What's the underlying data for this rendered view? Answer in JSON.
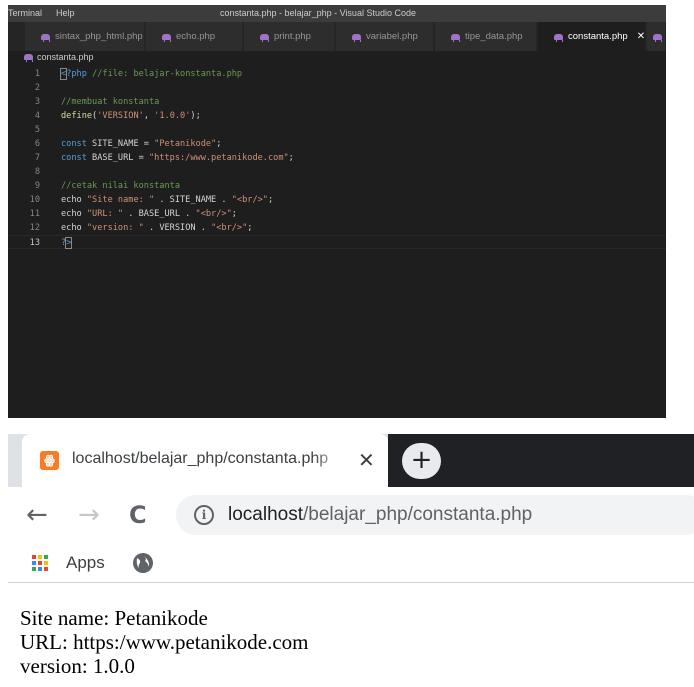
{
  "vscode": {
    "menu": [
      "Terminal",
      "Help"
    ],
    "window_title": "constanta.php - belajar_php - Visual Studio Code",
    "tabs": [
      {
        "label": "sintax_php_html.php",
        "active": false
      },
      {
        "label": "echo.php",
        "active": false
      },
      {
        "label": "print.php",
        "active": false
      },
      {
        "label": "variabel.php",
        "active": false
      },
      {
        "label": "tipe_data.php",
        "active": false
      },
      {
        "label": "constanta.php",
        "active": true
      }
    ],
    "close_glyph": "✕",
    "breadcrumb": "constanta.php",
    "current_line": 13,
    "lines": [
      {
        "n": "1",
        "tokens": [
          {
            "t": "<",
            "c": "t-tag bracket"
          },
          {
            "t": "?php ",
            "c": "t-tag"
          },
          {
            "t": "//file: belajar-konstanta.php",
            "c": "t-comment"
          }
        ]
      },
      {
        "n": "2",
        "tokens": []
      },
      {
        "n": "3",
        "tokens": [
          {
            "t": "//membuat konstanta",
            "c": "t-comment"
          }
        ]
      },
      {
        "n": "4",
        "tokens": [
          {
            "t": "define",
            "c": "t-func"
          },
          {
            "t": "(",
            "c": "t-plain"
          },
          {
            "t": "'VERSION'",
            "c": "t-string"
          },
          {
            "t": ", ",
            "c": "t-plain"
          },
          {
            "t": "'1.0.0'",
            "c": "t-string"
          },
          {
            "t": ");",
            "c": "t-plain"
          }
        ]
      },
      {
        "n": "5",
        "tokens": []
      },
      {
        "n": "6",
        "tokens": [
          {
            "t": "const",
            "c": "t-keyword"
          },
          {
            "t": " SITE_NAME = ",
            "c": "t-plain"
          },
          {
            "t": "\"Petanikode\"",
            "c": "t-string"
          },
          {
            "t": ";",
            "c": "t-plain"
          }
        ]
      },
      {
        "n": "7",
        "tokens": [
          {
            "t": "const",
            "c": "t-keyword"
          },
          {
            "t": " BASE_URL = ",
            "c": "t-plain"
          },
          {
            "t": "\"https:/www.petanikode.com\"",
            "c": "t-string"
          },
          {
            "t": ";",
            "c": "t-plain"
          }
        ]
      },
      {
        "n": "8",
        "tokens": []
      },
      {
        "n": "9",
        "tokens": [
          {
            "t": "//cetak nilai konstanta",
            "c": "t-comment"
          }
        ]
      },
      {
        "n": "10",
        "tokens": [
          {
            "t": "echo ",
            "c": "t-plain"
          },
          {
            "t": "\"Site name: \"",
            "c": "t-string"
          },
          {
            "t": " . SITE_NAME . ",
            "c": "t-plain"
          },
          {
            "t": "\"<br/>\"",
            "c": "t-string"
          },
          {
            "t": ";",
            "c": "t-plain"
          }
        ]
      },
      {
        "n": "11",
        "tokens": [
          {
            "t": "echo ",
            "c": "t-plain"
          },
          {
            "t": "\"URL: \"",
            "c": "t-string"
          },
          {
            "t": " . BASE_URL . ",
            "c": "t-plain"
          },
          {
            "t": "\"<br/>\"",
            "c": "t-string"
          },
          {
            "t": ";",
            "c": "t-plain"
          }
        ]
      },
      {
        "n": "12",
        "tokens": [
          {
            "t": "echo ",
            "c": "t-plain"
          },
          {
            "t": "\"version: \"",
            "c": "t-string"
          },
          {
            "t": " . VERSION . ",
            "c": "t-plain"
          },
          {
            "t": "\"<br/>\"",
            "c": "t-string"
          },
          {
            "t": ";",
            "c": "t-plain"
          }
        ]
      },
      {
        "n": "13",
        "tokens": [
          {
            "t": "?",
            "c": "t-tag"
          },
          {
            "t": ">",
            "c": "t-tag bracket"
          }
        ]
      }
    ]
  },
  "browser": {
    "tab_title": "localhost/belajar_php/constanta.php",
    "tab_close": "✕",
    "new_tab": "+",
    "favicon": "ꙮ",
    "back": "←",
    "forward": "→",
    "reload": "C",
    "info_glyph": "i",
    "url_host": "localhost",
    "url_path": "/belajar_php/constanta.php",
    "apps_label": "Apps",
    "apps_colors": [
      "#ea4335",
      "#fbbc04",
      "#34a853",
      "#4285f4",
      "#ea4335",
      "#fbbc04",
      "#34a853",
      "#4285f4",
      "#ea4335"
    ],
    "page_lines": [
      "Site name: Petanikode",
      "URL: https:/www.petanikode.com",
      "version: 1.0.0"
    ]
  }
}
